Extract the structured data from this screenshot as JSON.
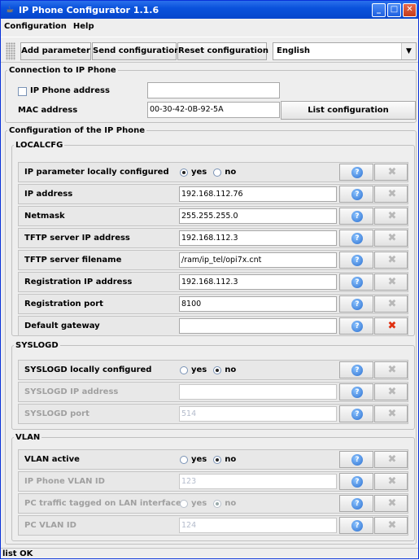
{
  "window": {
    "title": "IP Phone Configurator 1.1.6",
    "app_icon": "java-cup-icon"
  },
  "menu": {
    "items": [
      "Configuration",
      "Help"
    ]
  },
  "toolbar": {
    "add_label": "Add parameter",
    "send_label": "Send configuration",
    "reset_label": "Reset configuration",
    "language_selected": "English"
  },
  "connection": {
    "legend": "Connection to IP Phone",
    "ip_checkbox_label": "IP Phone address",
    "ip_value": "",
    "mac_label": "MAC address",
    "mac_value": "00-30-42-0B-92-5A",
    "list_button": "List configuration"
  },
  "config": {
    "legend": "Configuration of the IP Phone",
    "localcfg": {
      "legend": "LOCALCFG",
      "rows": [
        {
          "label": "IP parameter locally configured",
          "yes": "yes",
          "no": "no",
          "selected": "yes"
        },
        {
          "label": "IP address",
          "value": "192.168.112.76"
        },
        {
          "label": "Netmask",
          "value": "255.255.255.0"
        },
        {
          "label": "TFTP server IP address",
          "value": "192.168.112.3"
        },
        {
          "label": "TFTP server filename",
          "value": "/ram/ip_tel/opi7x.cnt"
        },
        {
          "label": "Registration IP address",
          "value": "192.168.112.3"
        },
        {
          "label": "Registration port",
          "value": "8100"
        },
        {
          "label": "Default gateway",
          "value": ""
        }
      ]
    },
    "syslogd": {
      "legend": "SYSLOGD",
      "rows": [
        {
          "label": "SYSLOGD locally configured",
          "yes": "yes",
          "no": "no",
          "selected": "no"
        },
        {
          "label": "SYSLOGD IP address",
          "value": ""
        },
        {
          "label": "SYSLOGD port",
          "value": "514"
        }
      ]
    },
    "vlan": {
      "legend": "VLAN",
      "rows": [
        {
          "label": "VLAN active",
          "yes": "yes",
          "no": "no",
          "selected": "no"
        },
        {
          "label": "IP Phone VLAN ID",
          "value": "123"
        },
        {
          "label": "PC traffic tagged on LAN interface",
          "yes": "yes",
          "no": "no",
          "selected": "no"
        },
        {
          "label": "PC VLAN ID",
          "value": "124"
        }
      ]
    }
  },
  "status": {
    "text": "list OK"
  },
  "icons": {
    "help": "help-icon",
    "delete": "delete-icon"
  },
  "colors": {
    "titlebar": "#0a52dc",
    "delete_active": "#e03010"
  }
}
